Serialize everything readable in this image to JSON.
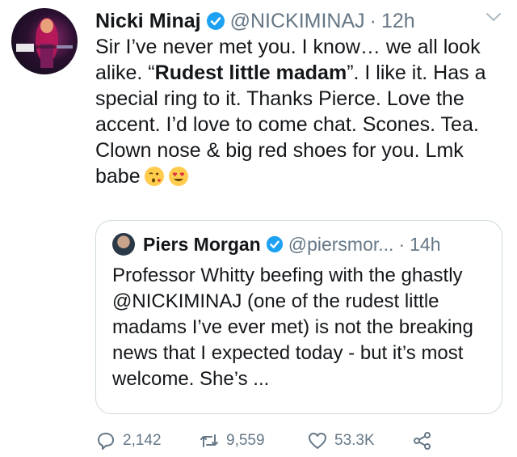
{
  "tweet": {
    "author_name": "Nicki Minaj",
    "author_handle": "@NICKIMINAJ",
    "separator": "·",
    "time": "12h",
    "avatar_text": "NICKI MINAJ",
    "text_part1": "Sir I’ve never met you. I know… we all look alike. “",
    "text_bold": "Rudest little madam",
    "text_part2": "”. I like it. Has a special ring to it. Thanks Pierce. Love the accent. I’d love to come chat. Scones. Tea. Clown nose & big red shoes for you. Lmk babe",
    "emojis": [
      "face-blowing-kiss-icon",
      "heart-eyes-icon"
    ]
  },
  "quoted": {
    "author_name": "Piers Morgan",
    "author_handle": "@piersmor...",
    "separator": "·",
    "time": "14h",
    "text": "Professor Whitty beefing with the ghastly @NICKIMINAJ (one of the rudest little madams I’ve ever met) is not the breaking news that I expected today - but it’s most welcome. She’s ..."
  },
  "actions": {
    "replies": "2,142",
    "retweets": "9,559",
    "likes": "53.3K"
  },
  "colors": {
    "verified": "#1da1f2",
    "secondary_text": "#657786",
    "border": "#cfd9de"
  }
}
